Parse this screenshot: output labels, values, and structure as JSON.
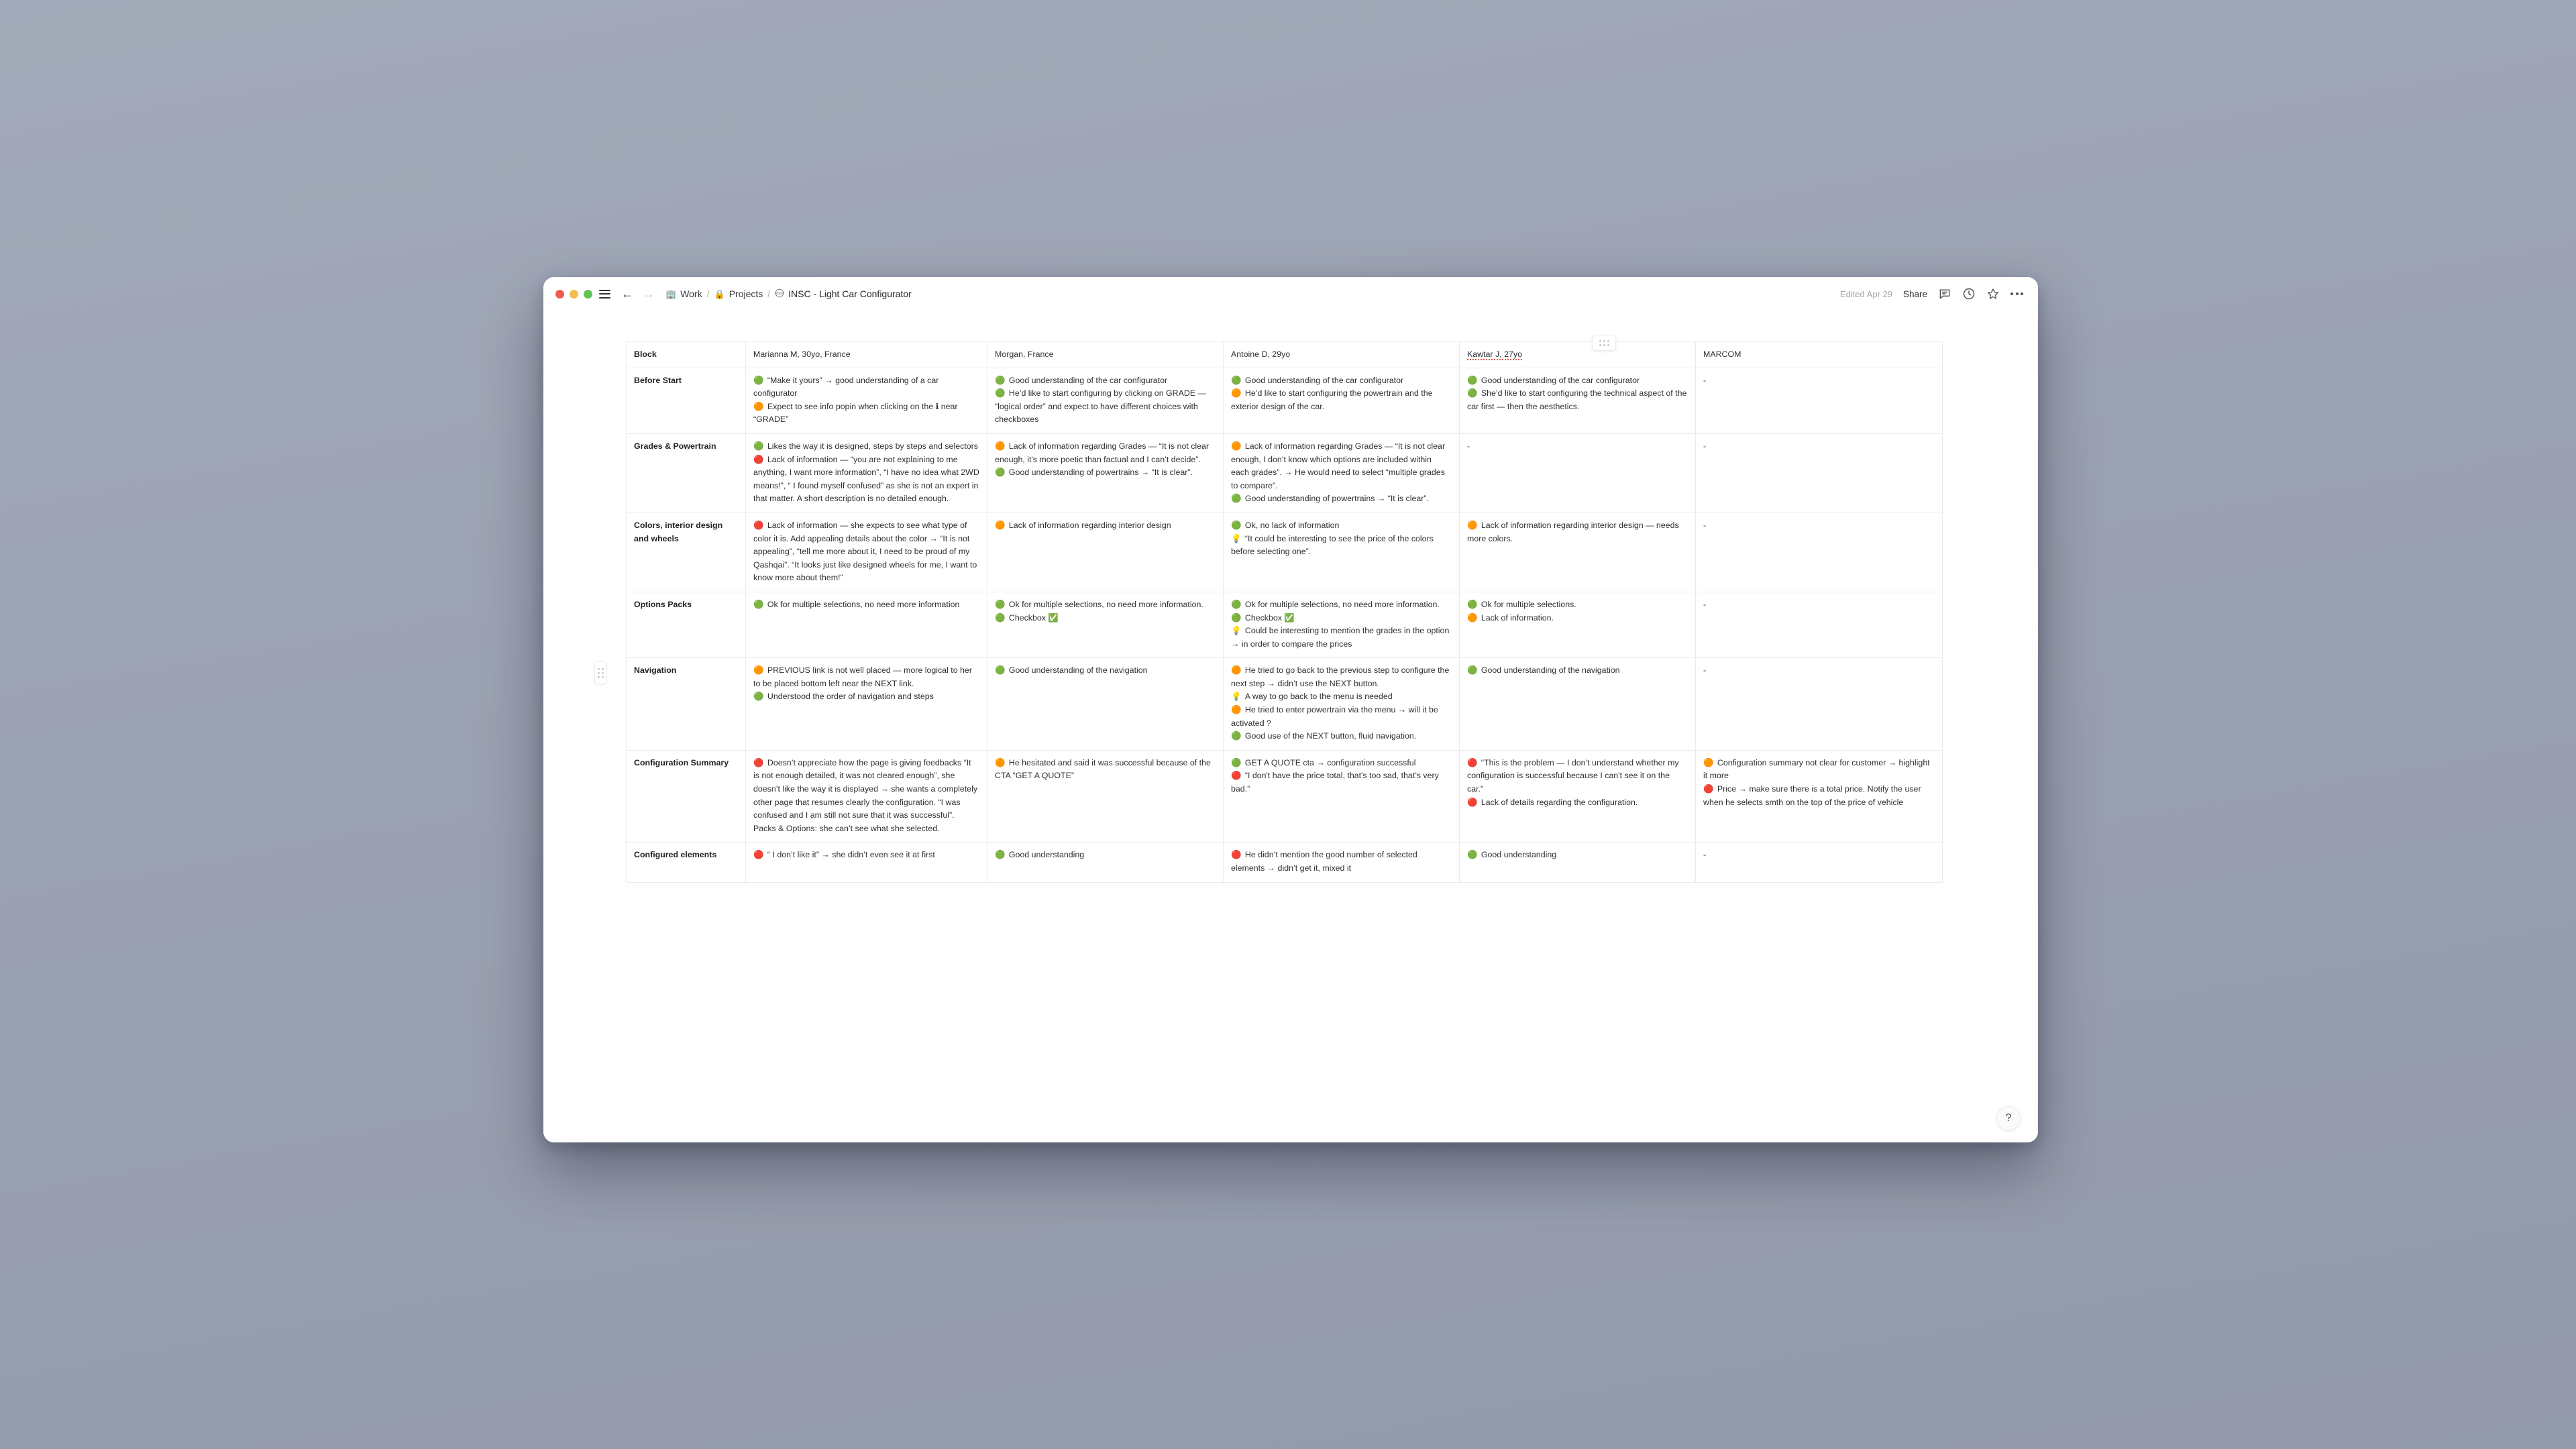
{
  "window": {
    "traffic_lights": [
      "close",
      "minimize",
      "zoom"
    ],
    "breadcrumb": {
      "workspace": "Work",
      "section": "Projects",
      "doc_title": "INSC - Light Car Configurator",
      "separator": "/"
    },
    "edited_label": "Edited Apr 29",
    "share_label": "Share",
    "help_label": "?"
  },
  "table": {
    "headers": [
      "Block",
      "Marianna M, 30yo, France",
      "Morgan, France",
      "Antoine D, 29yo",
      "Kawtar J, 27yo",
      "MARCOM"
    ],
    "rows": [
      {
        "block": "Before Start",
        "cells": [
          [
            {
              "icon": "green",
              "text": "“Make it yours” → good understanding of a car configurator"
            },
            {
              "icon": "orange",
              "text": "Expect to see info popin when clicking on the ℹ near “GRADE”"
            }
          ],
          [
            {
              "icon": "green",
              "text": "Good understanding of the car configurator"
            },
            {
              "icon": "green",
              "text": "He’d like to start configuring by clicking on GRADE — “logical order” and expect to have different choices with checkboxes"
            }
          ],
          [
            {
              "icon": "green",
              "text": "Good understanding of the car configurator"
            },
            {
              "icon": "orange",
              "text": "He’d like to start configuring the powertrain and the exterior design of the car."
            }
          ],
          [
            {
              "icon": "green",
              "text": "Good understanding of the car configurator"
            },
            {
              "icon": "green",
              "text": "She’d like to start configuring the technical aspect of the car first — then the aesthetics."
            }
          ],
          [
            {
              "icon": "none",
              "text": "-"
            }
          ]
        ]
      },
      {
        "block": "Grades & Powertrain",
        "cells": [
          [
            {
              "icon": "green",
              "text": "Likes the way it is designed, steps by steps and selectors"
            },
            {
              "icon": "red",
              "text": "Lack of information — “you are not explaining to me anything, I want more information”, “I have no idea what 2WD means!”, “ I found myself confused” as she is not an expert in that matter. A short description is no detailed enough."
            }
          ],
          [
            {
              "icon": "orange",
              "text": "Lack of information regarding Grades — “It is not clear enough, it's more poetic than factual and I can’t decide”."
            },
            {
              "icon": "green",
              "text": "Good understanding of powertrains → “It is clear”."
            }
          ],
          [
            {
              "icon": "orange",
              "text": "Lack of information regarding Grades — “It is not clear enough, I don’t know which options are included within each grades”. → He would need to select “multiple grades to compare”."
            },
            {
              "icon": "green",
              "text": "Good understanding of powertrains → “It is clear”."
            }
          ],
          [
            {
              "icon": "none",
              "text": "-"
            }
          ],
          [
            {
              "icon": "none",
              "text": "-"
            }
          ]
        ]
      },
      {
        "block": "Colors, interior design and wheels",
        "cells": [
          [
            {
              "icon": "red",
              "text": "Lack of information — she expects to see what type of color it is. Add appealing details about the color → “It is not appealing”, “tell me more about it, I need to be proud of my Qashqai”. “It looks just like designed wheels for me, I want to know more about them!”"
            }
          ],
          [
            {
              "icon": "orange",
              "text": "Lack of information regarding interior design"
            }
          ],
          [
            {
              "icon": "green",
              "text": "Ok, no lack of information"
            },
            {
              "icon": "bulb",
              "text": "“It could be interesting to see the price of the colors before selecting one”."
            }
          ],
          [
            {
              "icon": "orange",
              "text": "Lack of information regarding interior design — needs more colors."
            }
          ],
          [
            {
              "icon": "none",
              "text": "-"
            }
          ]
        ]
      },
      {
        "block": "Options Packs",
        "cells": [
          [
            {
              "icon": "green",
              "text": "Ok for multiple selections, no need more information"
            }
          ],
          [
            {
              "icon": "green",
              "text": "Ok for multiple selections, no need more information."
            },
            {
              "icon": "green",
              "text": "Checkbox ✅"
            }
          ],
          [
            {
              "icon": "green",
              "text": "Ok for multiple selections, no need more information."
            },
            {
              "icon": "green",
              "text": "Checkbox ✅"
            },
            {
              "icon": "bulb",
              "text": "Could be interesting to mention the grades in the option → in order to compare the prices"
            }
          ],
          [
            {
              "icon": "green",
              "text": "Ok for multiple selections."
            },
            {
              "icon": "orange",
              "text": "Lack of information."
            }
          ],
          [
            {
              "icon": "none",
              "text": "-"
            }
          ]
        ]
      },
      {
        "block": "Navigation",
        "cells": [
          [
            {
              "icon": "orange",
              "text": "PREVIOUS link is not well placed — more logical to her to be placed bottom left near the NEXT link."
            },
            {
              "icon": "green",
              "text": "Understood the order of navigation and steps"
            }
          ],
          [
            {
              "icon": "green",
              "text": "Good understanding of the navigation"
            }
          ],
          [
            {
              "icon": "orange",
              "text": "He tried to go back to the previous step to configure the next step → didn’t use the NEXT button."
            },
            {
              "icon": "bulb",
              "text": "A way to go back to the menu is needed"
            },
            {
              "icon": "orange",
              "text": "He tried to enter powertrain via the menu → will it be activated ?"
            },
            {
              "icon": "green",
              "text": "Good use of the NEXT button, fluid navigation."
            }
          ],
          [
            {
              "icon": "green",
              "text": "Good understanding of the navigation"
            }
          ],
          [
            {
              "icon": "none",
              "text": "-"
            }
          ]
        ]
      },
      {
        "block": "Configuration Summary",
        "cells": [
          [
            {
              "icon": "red",
              "text": "Doesn’t appreciate how the page is giving feedbacks “It is not enough detailed, it was not cleared enough”, she doesn’t like the way it is displayed → she wants a completely other page that resumes clearly the configuration. “I was confused and I am still not sure that it was successful”."
            },
            {
              "icon": "none",
              "text": "Packs & Options: she can’t see what she selected."
            }
          ],
          [
            {
              "icon": "orange",
              "text": "He hesitated and said it was successful because of the CTA “GET A QUOTE”"
            }
          ],
          [
            {
              "icon": "green",
              "text": "GET A QUOTE cta → configuration successful"
            },
            {
              "icon": "red",
              "text": "“I don't have the price total, that's too sad, that’s very bad.”"
            }
          ],
          [
            {
              "icon": "red",
              "text": "“This is the problem — I don’t understand whether my configuration is successful because I can't see it on the car.”"
            },
            {
              "icon": "red",
              "text": "Lack of details regarding the configuration."
            }
          ],
          [
            {
              "icon": "orange",
              "text": "Configuration summary not clear for customer → highlight it more"
            },
            {
              "icon": "red",
              "text": "Price → make sure there is a total price. Notify the user when he selects smth on the top of the price of vehicle"
            }
          ]
        ]
      },
      {
        "block": "Configured elements",
        "cells": [
          [
            {
              "icon": "red",
              "text": "“ I don’t like it” → she didn’t even see it at first"
            }
          ],
          [
            {
              "icon": "green",
              "text": "Good understanding"
            }
          ],
          [
            {
              "icon": "red",
              "text": "He didn’t mention the good number of selected elements → didn’t get it, mixed it"
            }
          ],
          [
            {
              "icon": "green",
              "text": "Good understanding"
            }
          ],
          [
            {
              "icon": "none",
              "text": "-"
            }
          ]
        ]
      }
    ]
  },
  "colors": {
    "green": "#2fb830",
    "orange": "#f08c18",
    "red": "#e8271e",
    "grid_line": "#eaebec",
    "text": "#2e3033",
    "muted": "#a2a4a9"
  }
}
